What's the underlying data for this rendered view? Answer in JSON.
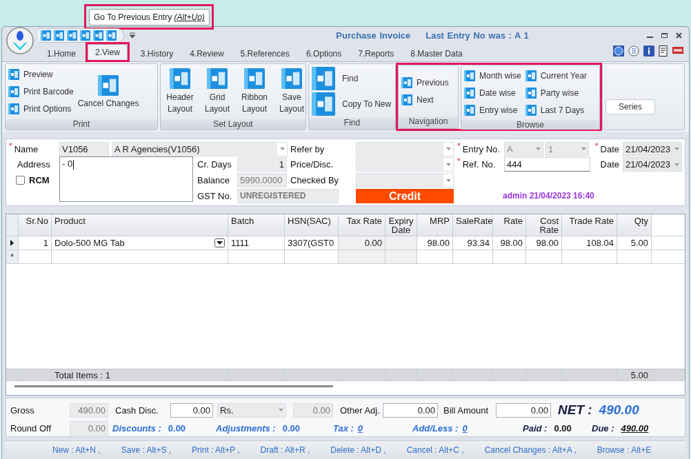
{
  "tooltip": {
    "text": "Go To Previous Entry",
    "shortcut": "(Alt+Up)",
    "highlighted": true
  },
  "window": {
    "title": "Purchase Invoice",
    "subtitle": "Last Entry No was : A 1"
  },
  "tabs": [
    {
      "label": "1.Home",
      "selected": false,
      "highlighted": false
    },
    {
      "label": "2.View",
      "selected": true,
      "highlighted": true
    },
    {
      "label": "3.History",
      "selected": false,
      "highlighted": false
    },
    {
      "label": "4.Review",
      "selected": false,
      "highlighted": false
    },
    {
      "label": "5.References",
      "selected": false,
      "highlighted": false
    },
    {
      "label": "6.Options",
      "selected": false,
      "highlighted": false
    },
    {
      "label": "7.Reports",
      "selected": false,
      "highlighted": false
    },
    {
      "label": "8.Master Data",
      "selected": false,
      "highlighted": false
    }
  ],
  "ribbon": [
    {
      "title": "Print",
      "highlighted": false,
      "items": [
        {
          "label": "Preview",
          "kind": "small"
        },
        {
          "label": "Print Barcode",
          "kind": "small"
        },
        {
          "label": "Print Options",
          "kind": "small"
        },
        {
          "label": "Cancel Changes",
          "kind": "wide"
        }
      ]
    },
    {
      "title": "Set Layout",
      "highlighted": false,
      "items": [
        {
          "label": "Header Layout",
          "kind": "tall"
        },
        {
          "label": "Grid Layout",
          "kind": "tall"
        },
        {
          "label": "Ribbon Layout",
          "kind": "tall"
        },
        {
          "label": "Save Layout",
          "kind": "tall"
        }
      ]
    },
    {
      "title": "Find",
      "highlighted": false,
      "items": [
        {
          "label": "Find",
          "kind": "medium"
        },
        {
          "label": "Copy To New",
          "kind": "medium"
        }
      ]
    },
    {
      "title": "Navigation",
      "highlighted": true,
      "items": [
        {
          "label": "Previous",
          "kind": "small"
        },
        {
          "label": "Next",
          "kind": "small"
        }
      ]
    },
    {
      "title": "Browse",
      "highlighted": true,
      "items": [
        {
          "label": "Month wise",
          "kind": "small"
        },
        {
          "label": "Date wise",
          "kind": "small"
        },
        {
          "label": "Entry wise",
          "kind": "small"
        },
        {
          "label": "Current Year",
          "kind": "small"
        },
        {
          "label": "Party wise",
          "kind": "small"
        },
        {
          "label": "Last 7 Days",
          "kind": "small"
        }
      ]
    },
    {
      "highlighted": false,
      "items": [
        {
          "label": "Series",
          "kind": "button"
        }
      ]
    }
  ],
  "required_mark": "*",
  "form": {
    "name": {
      "label": "Name",
      "code": "V1056",
      "value": "A R Agencies(V1056)",
      "required": true
    },
    "address": {
      "label": "Address",
      "value": "- 0"
    },
    "rcm": {
      "label": "RCM",
      "checked": false
    },
    "cr_days": {
      "label": "Cr. Days",
      "value": "1"
    },
    "balance": {
      "label": "Balance",
      "value": "5990.0000"
    },
    "gst_no": {
      "label": "GST No.",
      "value": "UNREGISTERED"
    },
    "refer_by": {
      "label": "Refer by"
    },
    "price_disc": {
      "label": "Price/Disc."
    },
    "checked_by": {
      "label": "Checked By"
    },
    "payment_mode": "Credit",
    "entry_no": {
      "label": "Entry No.",
      "series": "A",
      "number": "1",
      "required": true
    },
    "ref_no": {
      "label": "Ref. No.",
      "value": "444",
      "required": true
    },
    "date": {
      "label": "Date",
      "value": "21/04/2023",
      "required": true
    },
    "date_2": {
      "label": "Date",
      "value": "21/04/2023"
    },
    "audit": "admin 21/04/2023 16:40"
  },
  "grid": {
    "columns": [
      "Sr.No",
      "Product",
      "Batch",
      "HSN(SAC)",
      "Tax Rate",
      "Expiry Date",
      "MRP",
      "SaleRate",
      "Rate",
      "Cost Rate",
      "Trade Rate",
      "Qty"
    ],
    "rows": [
      {
        "current": true,
        "cells": [
          "1",
          "Dolo-500 MG Tab",
          "1111",
          "3307(GST0",
          "0.00",
          null,
          "98.00",
          "93.34",
          "98.00",
          "98.00",
          "108.04",
          "5.00"
        ]
      }
    ],
    "new_row_marker": "*",
    "total_label": "Total Items : 1",
    "total_qty": "5.00"
  },
  "totals": {
    "gross": {
      "label": "Gross",
      "value": "490.00"
    },
    "cash_disc": {
      "label": "Cash Disc.",
      "value": "0.00",
      "unit": "Rs.",
      "amount": "0.00"
    },
    "other_adj": {
      "label": "Other Adj.",
      "value": "0.00"
    },
    "bill_amount": {
      "label": "Bill Amount",
      "value": "0.00"
    },
    "net": {
      "label": "NET :",
      "value": "490.00"
    },
    "round_off": {
      "label": "Round Off",
      "value": "0.00"
    },
    "discounts": {
      "label": "Discounts :",
      "value": "0.00"
    },
    "adjustments": {
      "label": "Adjustments :",
      "value": "0.00"
    },
    "tax": {
      "label": "Tax :",
      "value": "0"
    },
    "add_less": {
      "label": "Add/Less :",
      "value": "0"
    },
    "paid": {
      "label": "Paid :",
      "value": "0.00"
    },
    "due": {
      "label": "Due :",
      "value": "490.00"
    }
  },
  "shortcuts": [
    "New : Alt+N ,",
    "Save : Alt+S ,",
    "Print : Alt+P ,",
    "Draft : Alt+R ,",
    "Delete : Alt+D ,",
    "Cancel : Alt+C ,",
    "Cancel Changes : Alt+A ,",
    "Browse : Alt+E"
  ]
}
